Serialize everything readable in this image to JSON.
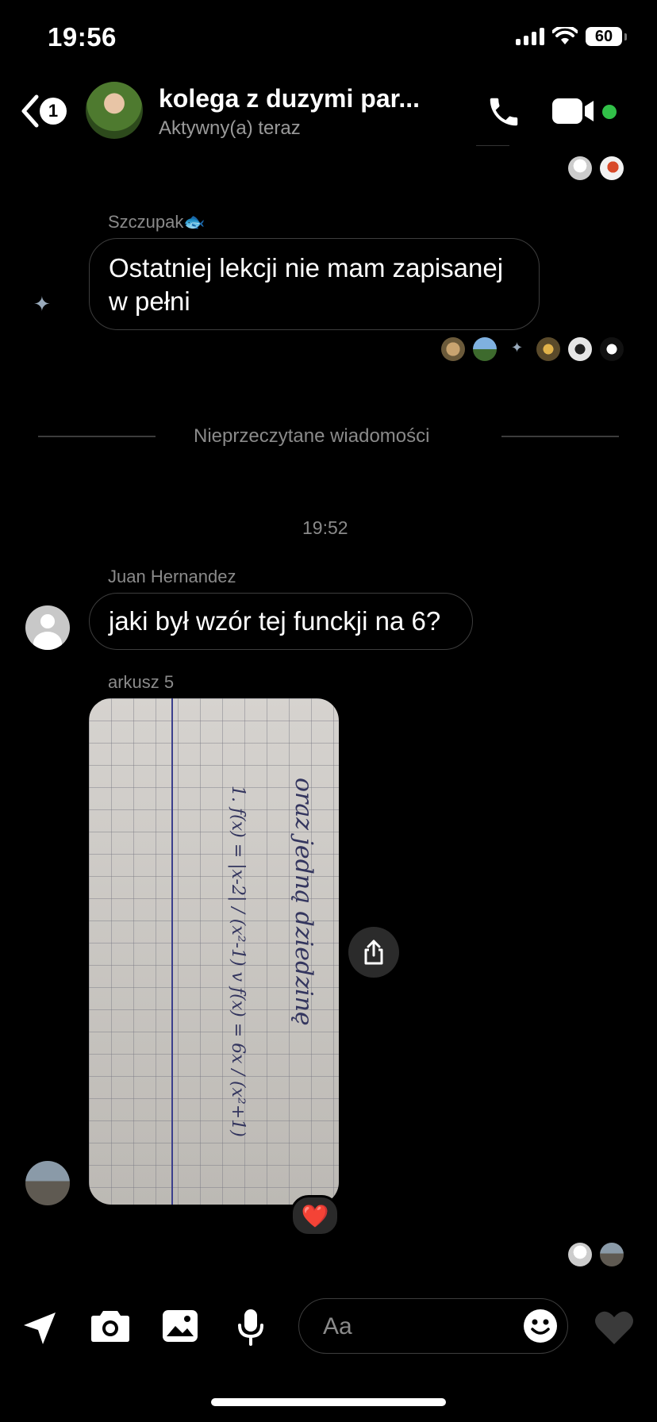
{
  "status_bar": {
    "time": "19:56",
    "battery": "60"
  },
  "header": {
    "back_badge": "1",
    "title": "kolega z duzymi par...",
    "status": "Aktywny(a) teraz"
  },
  "messages": [
    {
      "sender": "Szczupak🐟",
      "text": "Ostatniej lekcji nie mam zapisanej\nw pełni"
    },
    {
      "sender": "Juan Hernandez",
      "text": "jaki był wzór tej funckji na 6?"
    }
  ],
  "divider": {
    "label": "Nieprzeczytane wiadomości"
  },
  "timestamp": "19:52",
  "image_message": {
    "caption": "arkusz 5",
    "handwriting": {
      "line1": "oraz jedną dziedzinę",
      "line2": "1. f(x) = |x-2| / (x²-1)   v   f(x) = 6x / (x²+1)"
    },
    "reaction": "❤️"
  },
  "composer": {
    "placeholder": "Aa"
  },
  "colors": {
    "background": "#000000",
    "online": "#31c048",
    "reaction": "#e0243a"
  }
}
